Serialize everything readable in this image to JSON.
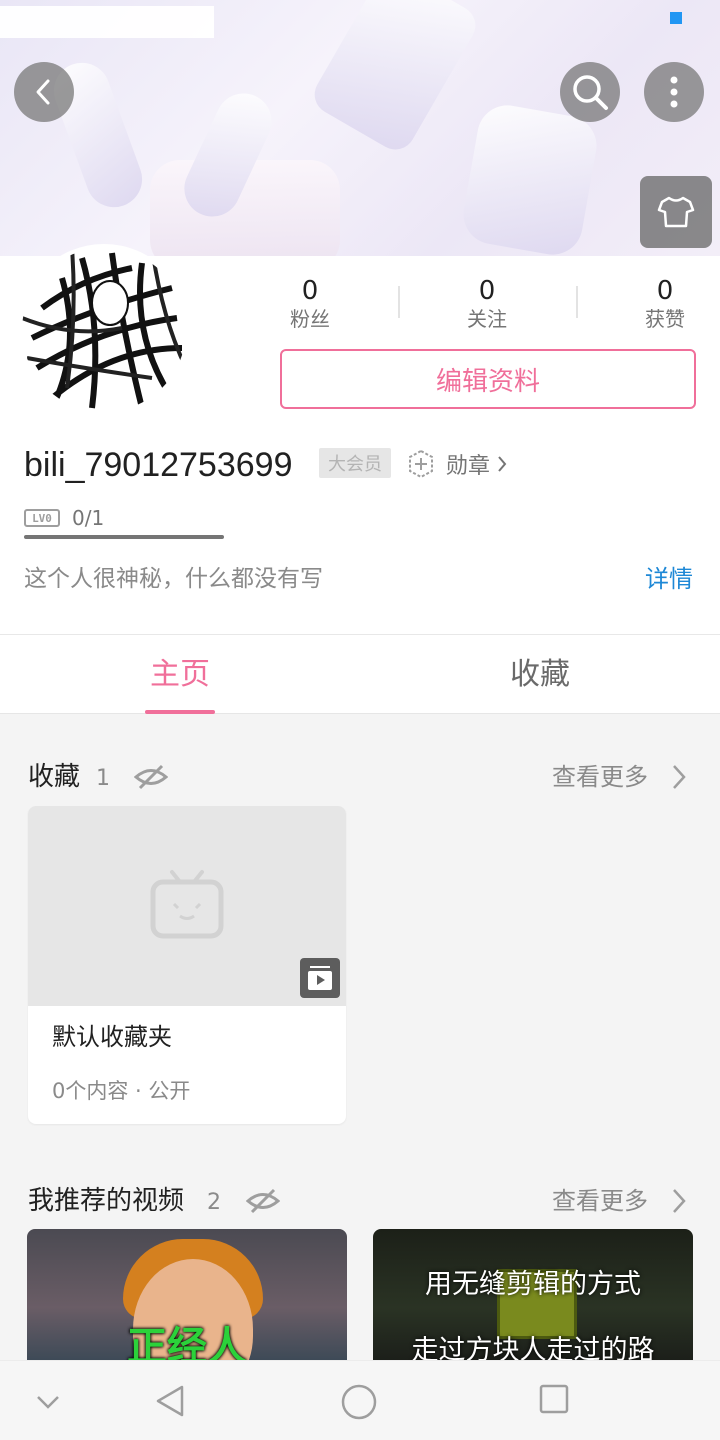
{
  "header": {
    "back_label": "back",
    "search_label": "search",
    "more_label": "more"
  },
  "profile": {
    "stats": [
      {
        "value": "0",
        "label": "粉丝"
      },
      {
        "value": "0",
        "label": "关注"
      },
      {
        "value": "0",
        "label": "获赞"
      }
    ],
    "edit_label": "编辑资料",
    "username": "bili_79012753699",
    "vip_badge": "大会员",
    "medal_label": "勋章",
    "level_badge": "LV0",
    "level_progress": "0/1",
    "signature": "这个人很神秘，什么都没有写",
    "detail_link": "详情"
  },
  "tabs": [
    {
      "label": "主页",
      "active": true
    },
    {
      "label": "收藏",
      "active": false
    }
  ],
  "favorites_section": {
    "title": "收藏",
    "count": "1",
    "more_label": "查看更多",
    "folder": {
      "name": "默认收藏夹",
      "meta": "0个内容 · 公开"
    }
  },
  "recommended_section": {
    "title": "我推荐的视频",
    "count": "2",
    "more_label": "查看更多",
    "videos": [
      {
        "caption": "正经人"
      },
      {
        "caption_line1": "用无缝剪辑的方式",
        "caption_line2": "走过方块人走过的路"
      }
    ]
  },
  "colors": {
    "accent": "#f06f9a",
    "link": "#1e88d6"
  }
}
